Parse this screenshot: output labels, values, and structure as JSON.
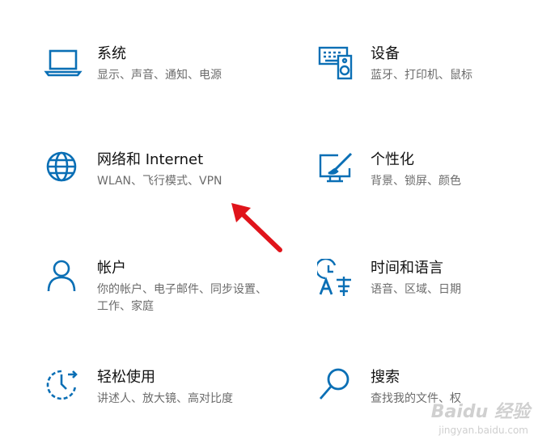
{
  "tiles": [
    {
      "id": "system",
      "title": "系统",
      "desc": "显示、声音、通知、电源",
      "icon": "laptop-icon"
    },
    {
      "id": "devices",
      "title": "设备",
      "desc": "蓝牙、打印机、鼠标",
      "icon": "keyboard-speaker-icon"
    },
    {
      "id": "network",
      "title": "网络和 Internet",
      "desc": "WLAN、飞行模式、VPN",
      "icon": "globe-icon"
    },
    {
      "id": "personalization",
      "title": "个性化",
      "desc": "背景、锁屏、颜色",
      "icon": "paint-monitor-icon"
    },
    {
      "id": "accounts",
      "title": "帐户",
      "desc": "你的帐户、电子邮件、同步设置、工作、家庭",
      "icon": "person-icon"
    },
    {
      "id": "time-language",
      "title": "时间和语言",
      "desc": "语音、区域、日期",
      "icon": "time-language-icon"
    },
    {
      "id": "ease-of-access",
      "title": "轻松使用",
      "desc": "讲述人、放大镜、高对比度",
      "icon": "ease-of-access-icon"
    },
    {
      "id": "search",
      "title": "搜索",
      "desc": "查找我的文件、权",
      "icon": "search-icon"
    }
  ],
  "watermark": {
    "top": "Baidu 经验",
    "bottom": "jingyan.baidu.com"
  },
  "colors": {
    "accent": "#0a6fb5",
    "arrow": "#e0141b"
  }
}
